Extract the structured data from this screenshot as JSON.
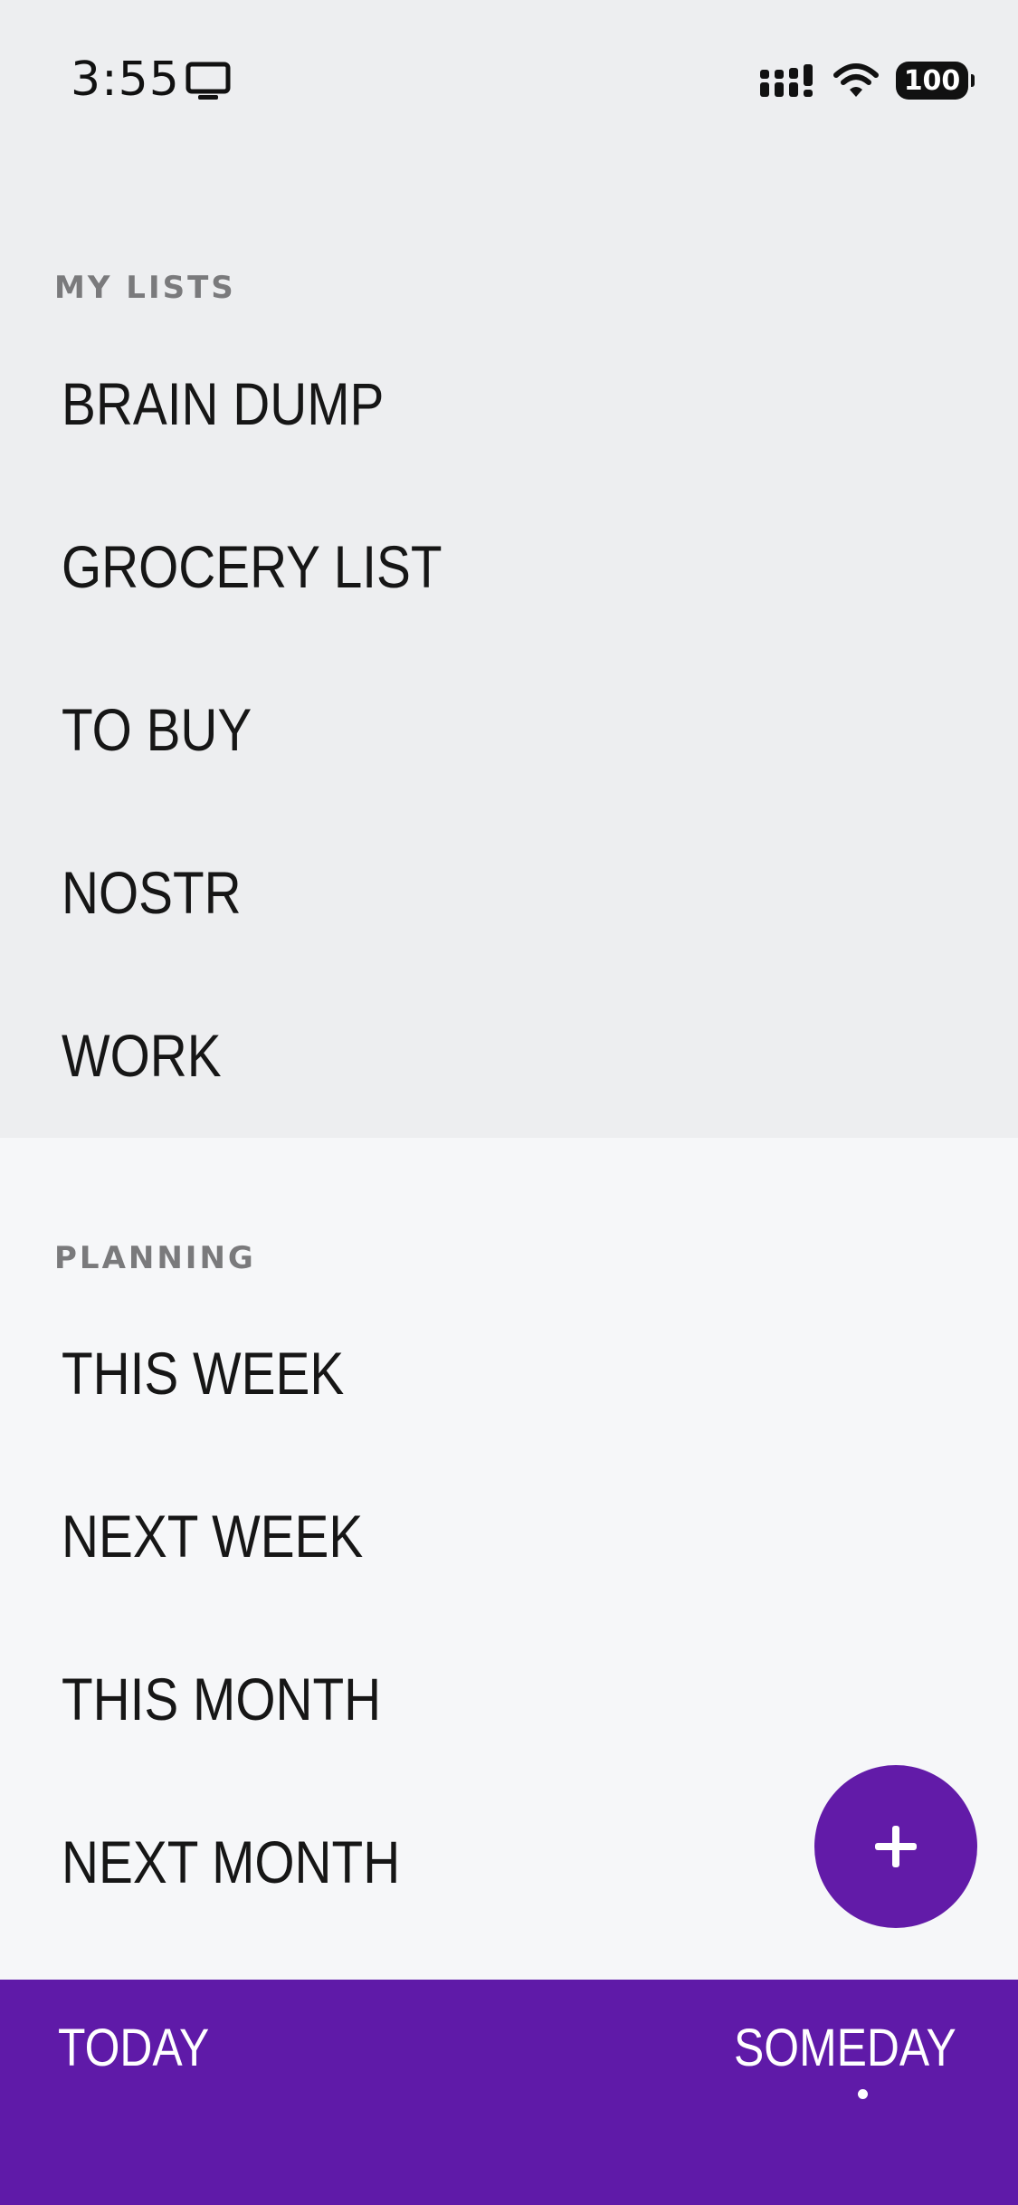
{
  "status_bar": {
    "time": "3:55",
    "battery": "100",
    "icons": [
      "screen-mirroring-icon",
      "cellular-signal-icon",
      "wifi-icon",
      "battery-icon"
    ]
  },
  "my_lists": {
    "header": "MY LISTS",
    "items": [
      {
        "label": "BRAIN DUMP"
      },
      {
        "label": "GROCERY LIST"
      },
      {
        "label": "TO BUY"
      },
      {
        "label": "NOSTR"
      },
      {
        "label": "WORK"
      }
    ]
  },
  "planning": {
    "header": "PLANNING",
    "items": [
      {
        "label": "THIS WEEK"
      },
      {
        "label": "NEXT WEEK"
      },
      {
        "label": "THIS MONTH"
      },
      {
        "label": "NEXT MONTH"
      }
    ]
  },
  "fab": {
    "icon": "plus-icon"
  },
  "bottom_nav": {
    "today": "TODAY",
    "someday": "SOMEDAY",
    "active": "someday"
  },
  "colors": {
    "accent": "#5f1aa8",
    "fab": "#621ba8",
    "section_my_lists_bg": "#edeef0",
    "section_planning_bg": "#f6f7f9",
    "text": "#161616",
    "header_text": "#7a7a7c"
  }
}
